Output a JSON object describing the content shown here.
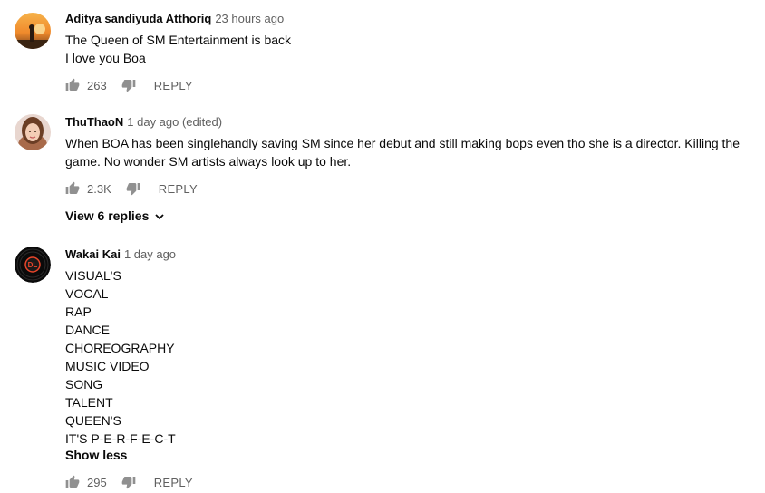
{
  "comments": [
    {
      "author": "Aditya sandiyuda Atthoriq",
      "time": "23 hours ago",
      "lines": [
        "The Queen of SM Entertainment is back",
        "I love you Boa"
      ],
      "likes": "263",
      "reply_label": "REPLY"
    },
    {
      "author": "ThuThaoN",
      "time": "1 day ago (edited)",
      "lines": [
        "When BOA has been singlehandly saving SM since her debut and still making bops even tho she is a director. Killing the",
        "game. No wonder SM artists always look up to her."
      ],
      "likes": "2.3K",
      "reply_label": "REPLY",
      "view_replies": "View 6 replies"
    },
    {
      "author": "Wakai Kai",
      "time": "1 day ago",
      "avatar_text": "DL",
      "lines": [
        "VISUAL'S",
        "VOCAL",
        "RAP",
        "DANCE",
        "CHOREOGRAPHY",
        "MUSIC VIDEO",
        "SONG",
        "TALENT",
        "QUEEN'S",
        "IT'S P-E-R-F-E-C-T"
      ],
      "show_less": "Show less",
      "likes": "295",
      "reply_label": "REPLY"
    }
  ],
  "colors": {
    "text": "#0a0a0a",
    "secondary": "#606060",
    "icon": "#909090"
  },
  "icons": [
    "thumb-up-icon",
    "thumb-down-icon",
    "chevron-down-icon"
  ]
}
